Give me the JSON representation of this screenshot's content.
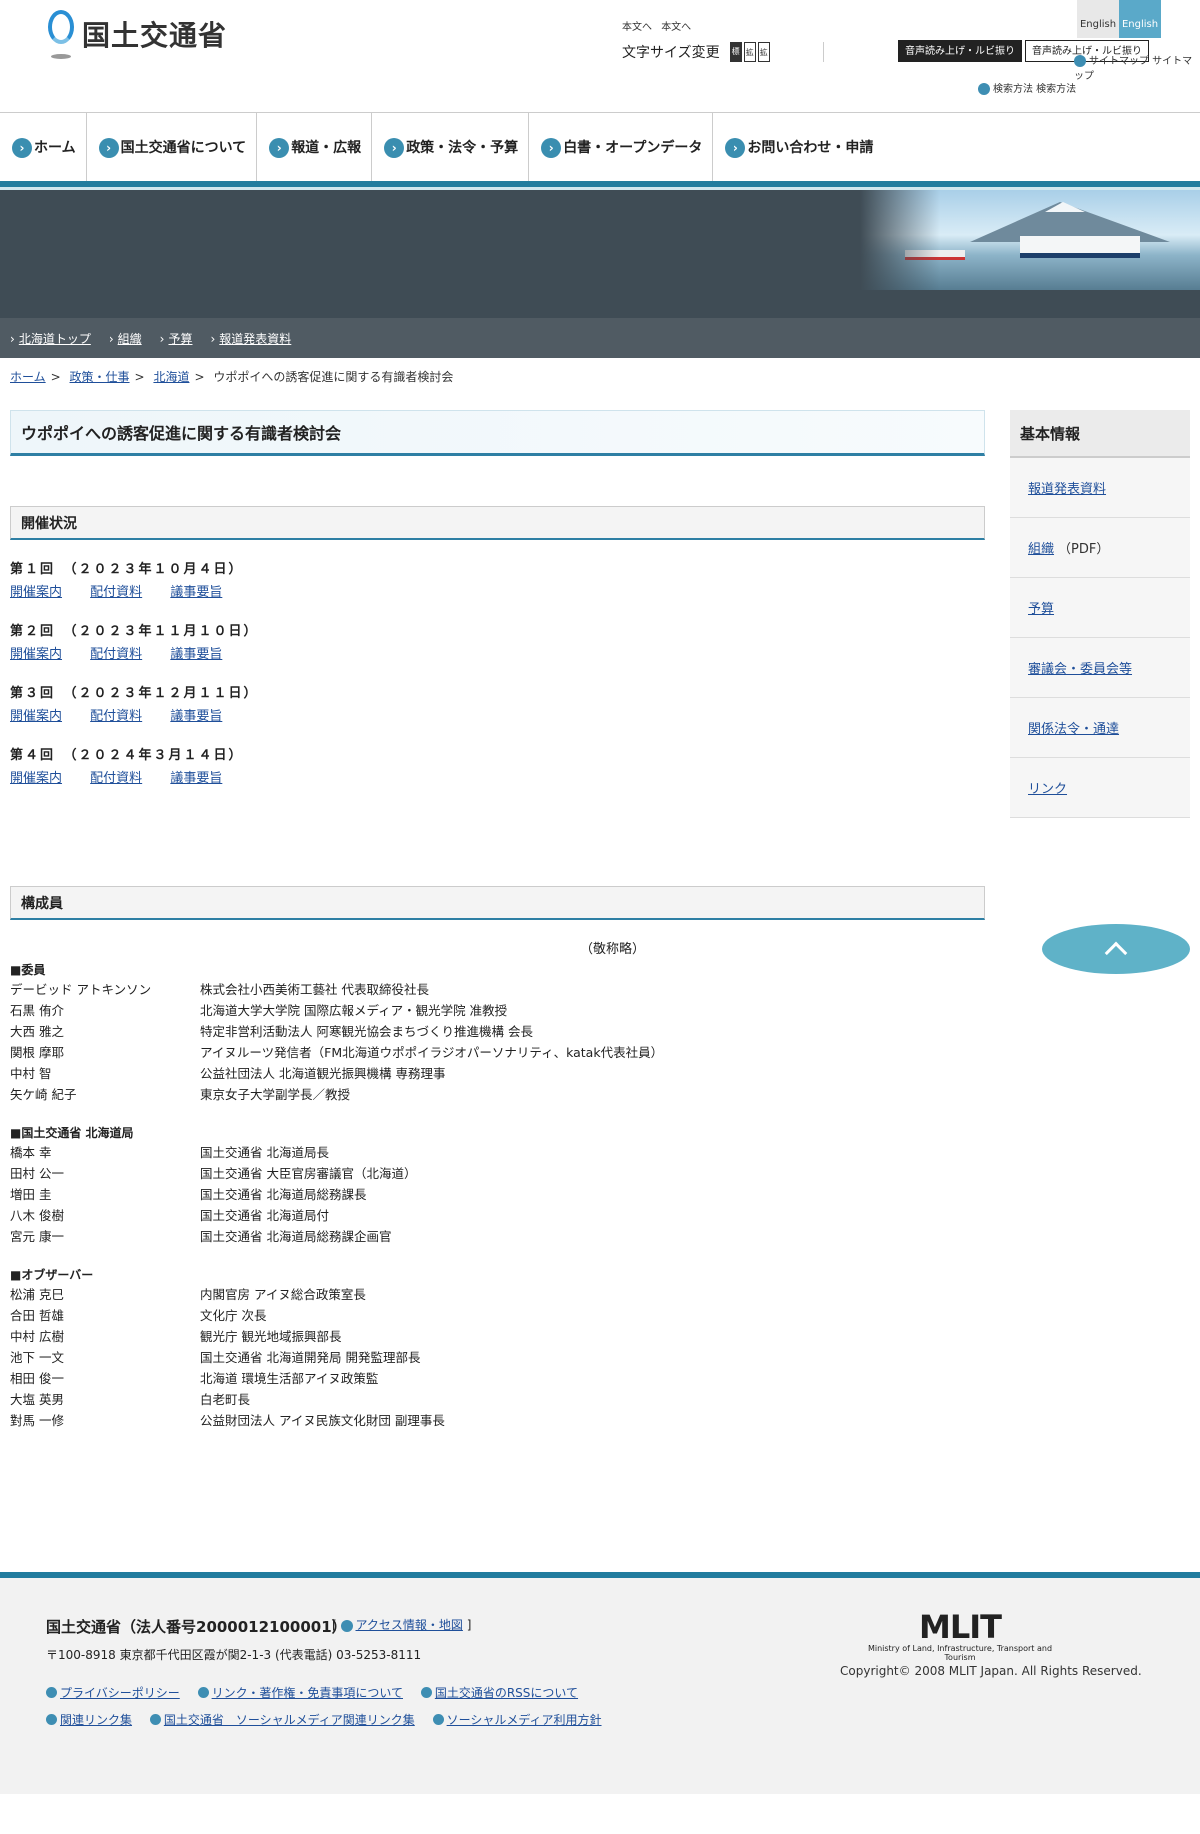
{
  "header": {
    "logo_text": "国土交通省",
    "skip_links": [
      "本文へ",
      "本文へ"
    ],
    "font_size_label": "文字サイズ変更",
    "font_buttons": [
      "標",
      "拡",
      "拡"
    ],
    "voice_buttons": [
      "音声読み上げ・ルビ振り",
      "音声読み上げ・ルビ振り"
    ],
    "english": [
      "English",
      "English"
    ],
    "sitemap": "サイトマップ サイトマップ",
    "search_method": "検索方法 検索方法"
  },
  "nav": {
    "items": [
      "ホーム",
      "国土交通省について",
      "報道・広報",
      "政策・法令・予算",
      "白書・オープンデータ",
      "お問い合わせ・申請"
    ]
  },
  "subnav": {
    "items": [
      "北海道トップ",
      "組織",
      "予算",
      "報道発表資料"
    ]
  },
  "breadcrumb": {
    "items": [
      "ホーム",
      "政策・仕事",
      "北海道"
    ],
    "current": "ウポポイへの誘客促進に関する有識者検討会"
  },
  "main": {
    "title": "ウポポイへの誘客促進に関する有識者検討会",
    "status_heading": "開催状況",
    "meetings": [
      {
        "title": "第１回　（２０２３年１０月４日）",
        "links": [
          "開催案内",
          "配付資料",
          "議事要旨"
        ]
      },
      {
        "title": "第２回　（２０２３年１１月１０日）",
        "links": [
          "開催案内",
          "配付資料",
          "議事要旨"
        ]
      },
      {
        "title": "第３回　（２０２３年１２月１１日）",
        "links": [
          "開催案内",
          "配付資料",
          "議事要旨"
        ]
      },
      {
        "title": "第４回　（２０２４年３月１４日）",
        "links": [
          "開催案内",
          "配付資料",
          "議事要旨"
        ]
      }
    ],
    "members_heading": "構成員",
    "honorific": "（敬称略）",
    "groups": [
      {
        "heading": "■委員",
        "members": [
          {
            "name": "デービッド アトキンソン",
            "role": "株式会社小西美術工藝社 代表取締役社長"
          },
          {
            "name": "石黒 侑介",
            "role": "北海道大学大学院 国際広報メディア・観光学院 准教授"
          },
          {
            "name": "大西 雅之",
            "role": "特定非営利活動法人 阿寒観光協会まちづくり推進機構 会長"
          },
          {
            "name": "関根 摩耶",
            "role": "アイヌルーツ発信者（FM北海道ウポポイラジオパーソナリティ、katak代表社員）"
          },
          {
            "name": "中村 智",
            "role": "公益社団法人 北海道観光振興機構 専務理事"
          },
          {
            "name": "矢ケ崎 紀子",
            "role": "東京女子大学副学長／教授"
          }
        ]
      },
      {
        "heading": "■国土交通省 北海道局",
        "members": [
          {
            "name": "橋本 幸",
            "role": "国土交通省 北海道局長"
          },
          {
            "name": "田村 公一",
            "role": "国土交通省 大臣官房審議官（北海道）"
          },
          {
            "name": "増田 圭",
            "role": "国土交通省 北海道局総務課長"
          },
          {
            "name": "八木 俊樹",
            "role": "国土交通省 北海道局付"
          },
          {
            "name": "宮元 康一",
            "role": "国土交通省 北海道局総務課企画官"
          }
        ]
      },
      {
        "heading": "■オブザーバー",
        "members": [
          {
            "name": "松浦 克巳",
            "role": "内閣官房 アイヌ総合政策室長"
          },
          {
            "name": "合田 哲雄",
            "role": "文化庁 次長"
          },
          {
            "name": "中村 広樹",
            "role": "観光庁 観光地域振興部長"
          },
          {
            "name": "池下 一文",
            "role": "国土交通省 北海道開発局 開発監理部長"
          },
          {
            "name": "相田 俊一",
            "role": "北海道 環境生活部アイヌ政策監"
          },
          {
            "name": "大塩 英男",
            "role": "白老町長"
          },
          {
            "name": "對馬 一修",
            "role": "公益財団法人 アイヌ民族文化財団 副理事長"
          }
        ]
      }
    ]
  },
  "sidebar": {
    "heading": "基本情報",
    "items": [
      {
        "label": "報道発表資料",
        "note": ""
      },
      {
        "label": "組織",
        "note": "（PDF）"
      },
      {
        "label": "予算",
        "note": ""
      },
      {
        "label": "審議会・委員会等",
        "note": ""
      },
      {
        "label": "関係法令・通達",
        "note": ""
      },
      {
        "label": "リンク",
        "note": ""
      }
    ]
  },
  "footer": {
    "org": "国土交通省（法人番号2000012100001）",
    "access_link": "アクセス情報・地図",
    "address": "〒100-8918 東京都千代田区霞が関2-1-3 (代表電話) 03-5253-8111",
    "links_row1": [
      "プライバシーポリシー",
      "リンク・著作権・免責事項について",
      "国土交通省のRSSについて"
    ],
    "links_row2": [
      "関連リンク集",
      "国土交通省　ソーシャルメディア関連リンク集",
      "ソーシャルメディア利用方針"
    ],
    "mlit_logo": "MLIT",
    "mlit_sub": "Ministry of Land, Infrastructure, Transport and Tourism",
    "copyright": "Copyright© 2008 MLIT Japan. All Rights Reserved."
  },
  "colors": {
    "accent": "#217c9e",
    "nav_icon": "#3a8eb0",
    "banner_bg": "#3f4c55",
    "subnav_bg": "#505b63",
    "link": "#1f4f9a",
    "pagetop": "#5fb2c8"
  }
}
